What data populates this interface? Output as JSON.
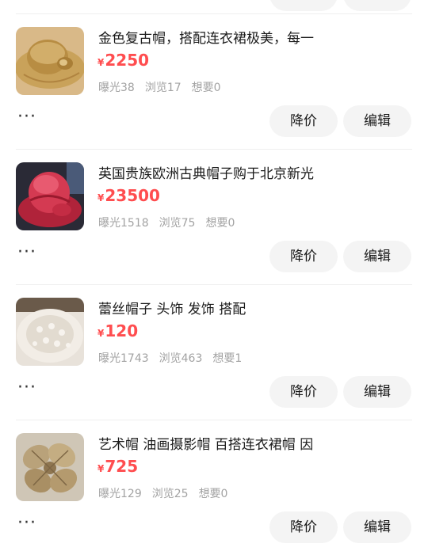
{
  "listings": [
    {
      "title": "金色复古帽，搭配连衣裙极美，每一",
      "currency": "¥",
      "price": "2250",
      "exposure": "曝光38",
      "views": "浏览17",
      "wants": "想要0",
      "more": "···",
      "reduce_label": "降价",
      "edit_label": "编辑"
    },
    {
      "title": "英国贵族欧洲古典帽子购于北京新光",
      "currency": "¥",
      "price": "23500",
      "exposure": "曝光1518",
      "views": "浏览75",
      "wants": "想要0",
      "more": "···",
      "reduce_label": "降价",
      "edit_label": "编辑"
    },
    {
      "title": "蕾丝帽子 头饰 发饰 搭配",
      "currency": "¥",
      "price": "120",
      "exposure": "曝光1743",
      "views": "浏览463",
      "wants": "想要1",
      "more": "···",
      "reduce_label": "降价",
      "edit_label": "编辑"
    },
    {
      "title": "艺术帽 油画摄影帽 百搭连衣裙帽 因",
      "currency": "¥",
      "price": "725",
      "exposure": "曝光129",
      "views": "浏览25",
      "wants": "想要0",
      "more": "···",
      "reduce_label": "降价",
      "edit_label": "编辑"
    }
  ],
  "colors": {
    "price": "#ff4d4f",
    "muted": "#a3a3a3",
    "pill": "#f4f4f4",
    "divider": "#efefef"
  }
}
